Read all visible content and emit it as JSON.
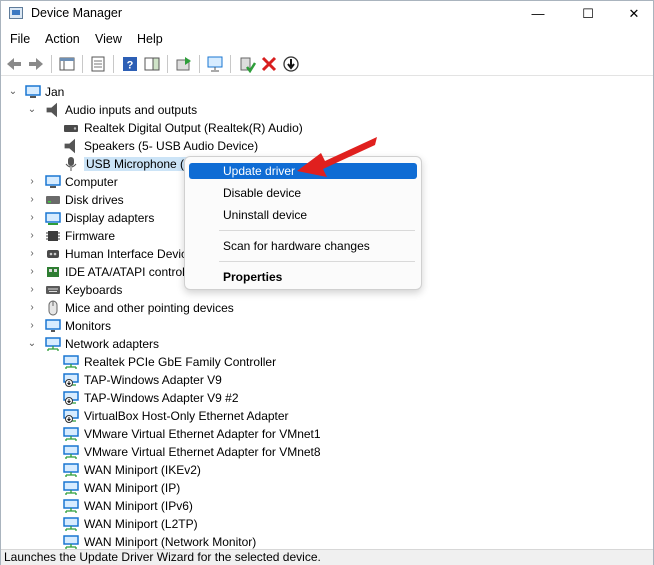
{
  "window": {
    "title": "Device Manager",
    "controls": {
      "minimize": "—",
      "maximize": "☐",
      "close": "✕"
    }
  },
  "menu": [
    "File",
    "Action",
    "View",
    "Help"
  ],
  "toolbar_icons": [
    "back-arrow-icon",
    "forward-arrow-icon",
    "show-hide-console-tree-icon",
    "properties-icon",
    "help-icon",
    "action-pane-icon",
    "update-driver-icon",
    "scan-hardware-icon",
    "enable-device-icon",
    "uninstall-device-icon",
    "disable-device-icon"
  ],
  "tree": {
    "root": "Jan",
    "items": [
      {
        "label": "Audio inputs and outputs",
        "expanded": true,
        "icon": "speaker-icon"
      },
      {
        "label": "Realtek Digital Output (Realtek(R) Audio)",
        "icon": "audio-device-icon"
      },
      {
        "label": "Speakers (5- USB Audio Device)",
        "icon": "speaker-icon"
      },
      {
        "label": "USB Microphone (5",
        "icon": "microphone-icon",
        "selected": true
      },
      {
        "label": "Computer",
        "icon": "computer-icon"
      },
      {
        "label": "Disk drives",
        "icon": "disk-drive-icon"
      },
      {
        "label": "Display adapters",
        "icon": "display-adapter-icon"
      },
      {
        "label": "Firmware",
        "icon": "firmware-icon"
      },
      {
        "label": "Human Interface Devic",
        "icon": "hid-icon"
      },
      {
        "label": "IDE ATA/ATAPI controll",
        "icon": "ide-controller-icon"
      },
      {
        "label": "Keyboards",
        "icon": "keyboard-icon"
      },
      {
        "label": "Mice and other pointing devices",
        "icon": "mouse-icon"
      },
      {
        "label": "Monitors",
        "icon": "monitor-icon"
      },
      {
        "label": "Network adapters",
        "expanded": true,
        "icon": "network-adapter-icon"
      },
      {
        "label": "Realtek PCIe GbE Family Controller",
        "icon": "network-adapter-icon"
      },
      {
        "label": "TAP-Windows Adapter V9",
        "icon": "network-adapter-icon"
      },
      {
        "label": "TAP-Windows Adapter V9 #2",
        "icon": "network-adapter-icon"
      },
      {
        "label": "VirtualBox Host-Only Ethernet Adapter",
        "icon": "network-adapter-icon"
      },
      {
        "label": "VMware Virtual Ethernet Adapter for VMnet1",
        "icon": "network-adapter-icon"
      },
      {
        "label": "VMware Virtual Ethernet Adapter for VMnet8",
        "icon": "network-adapter-icon"
      },
      {
        "label": "WAN Miniport (IKEv2)",
        "icon": "network-adapter-icon"
      },
      {
        "label": "WAN Miniport (IP)",
        "icon": "network-adapter-icon"
      },
      {
        "label": "WAN Miniport (IPv6)",
        "icon": "network-adapter-icon"
      },
      {
        "label": "WAN Miniport (L2TP)",
        "icon": "network-adapter-icon"
      },
      {
        "label": "WAN Miniport (Network Monitor)",
        "icon": "network-adapter-icon"
      }
    ]
  },
  "context_menu": {
    "items": [
      "Update driver",
      "Disable device",
      "Uninstall device",
      "Scan for hardware changes",
      "Properties"
    ],
    "highlighted": "Update driver"
  },
  "status_bar": "Launches the Update Driver Wizard for the selected device.",
  "colors": {
    "highlight": "#0f6cd4",
    "arrow": "#e0201e",
    "selection": "#cce4f7"
  }
}
